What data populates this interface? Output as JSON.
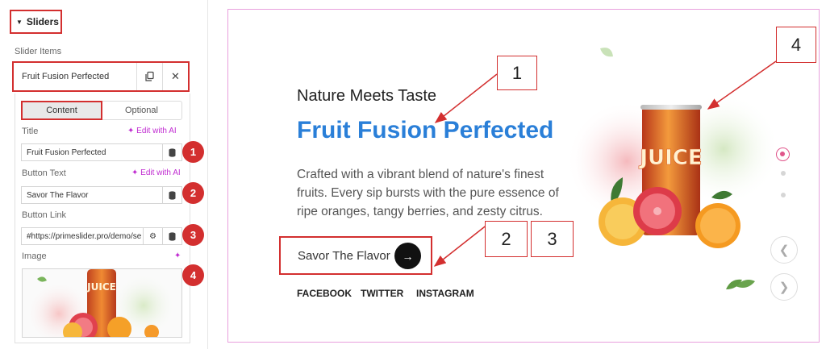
{
  "panel": {
    "section_title": "Sliders",
    "items_label": "Slider Items",
    "item": {
      "title": "Fruit Fusion Perfected"
    },
    "tabs": [
      {
        "label": "Content",
        "active": true
      },
      {
        "label": "Optional",
        "active": false
      }
    ],
    "fields": {
      "title": {
        "label": "Title",
        "ai_link": "Edit with AI",
        "value": "Fruit Fusion Perfected"
      },
      "button_text": {
        "label": "Button Text",
        "ai_link": "Edit with AI",
        "value": "Savor The Flavor"
      },
      "button_link": {
        "label": "Button Link",
        "value": "#https://primeslider.pro/demo/se"
      },
      "image": {
        "label": "Image"
      }
    },
    "badges": [
      "1",
      "2",
      "3",
      "4"
    ]
  },
  "preview": {
    "subtitle": "Nature Meets Taste",
    "title": "Fruit Fusion Perfected",
    "description": "Crafted with a vibrant blend of nature's finest fruits. Every sip bursts with the pure essence of ripe oranges, tangy berries, and zesty citrus.",
    "button_text": "Savor The Flavor",
    "social": [
      "FACEBOOK",
      "TWITTER",
      "INSTAGRAM"
    ],
    "can_label": "JUICE",
    "pagination": {
      "count": 3,
      "active": 1
    },
    "callouts": [
      "1",
      "2",
      "3",
      "4"
    ]
  },
  "colors": {
    "accent_red": "#d32f2f",
    "title_blue": "#2a7fd8",
    "ai_purple": "#c02bd1",
    "preview_border": "#e8a0dd",
    "active_dot": "#e0568b"
  },
  "icons": {
    "duplicate": "copy-icon",
    "remove": "close-icon",
    "dynamic": "database-icon",
    "settings": "gear-icon",
    "ai": "sparkle-icon",
    "cta": "arrow-right-icon",
    "prev": "chevron-left-icon",
    "next": "chevron-right-icon"
  }
}
